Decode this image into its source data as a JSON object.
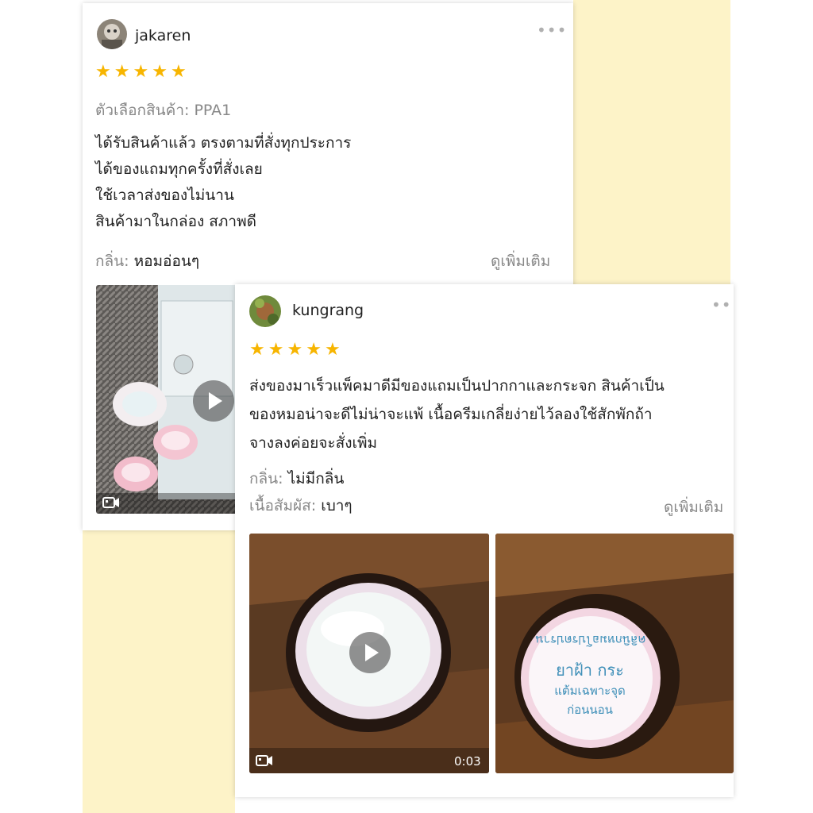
{
  "colors": {
    "background_panel": "#fdf3c8",
    "star": "#f7b500",
    "meta_text": "#888888"
  },
  "review1": {
    "username": "jakaren",
    "rating": 5,
    "variant": "ตัวเลือกสินค้า: PPA1",
    "lines": [
      "ได้รับสินค้าแล้ว ตรงตามที่สั่งทุกประการ",
      "ได้ของแถมทุกครั้งที่สั่งเลย",
      "ใช้เวลาส่งของไม่นาน",
      "สินค้ามาในกล่อง สภาพดี"
    ],
    "scent_label": "กลิ่น:",
    "scent_value": "หอมอ่อนๆ",
    "see_more": "ดูเพิ่มเติม",
    "more_icon": "more-dots-icon"
  },
  "review2": {
    "username": "kungrang",
    "rating": 5,
    "lines": [
      "ส่งของมาเร็วแพ็คมาดีมีของแถมเป็นปากกาและกระจก สินค้าเป็น",
      "ของหมอน่าจะดีไม่น่าจะแพ้ เนื้อครีมเกลี่ยง่ายไว้ลองใช้สักพักถ้า",
      "จางลงค่อยจะสั่งเพิ่ม"
    ],
    "scent_label": "กลิ่น:",
    "scent_value": "ไม่มีกลิ่น",
    "texture_label": "เนื้อสัมผัส:",
    "texture_value": "เบาๆ",
    "see_more": "ดูเพิ่มเติม",
    "video_duration": "0:03",
    "jar_label": {
      "arc": "คลินิกหมอโปรดปราน",
      "line1": "ยาฝ้า กระ",
      "line2": "แต้มเฉพาะจุด",
      "line3": "ก่อนนอน"
    },
    "more_icon": "more-dots-icon"
  }
}
